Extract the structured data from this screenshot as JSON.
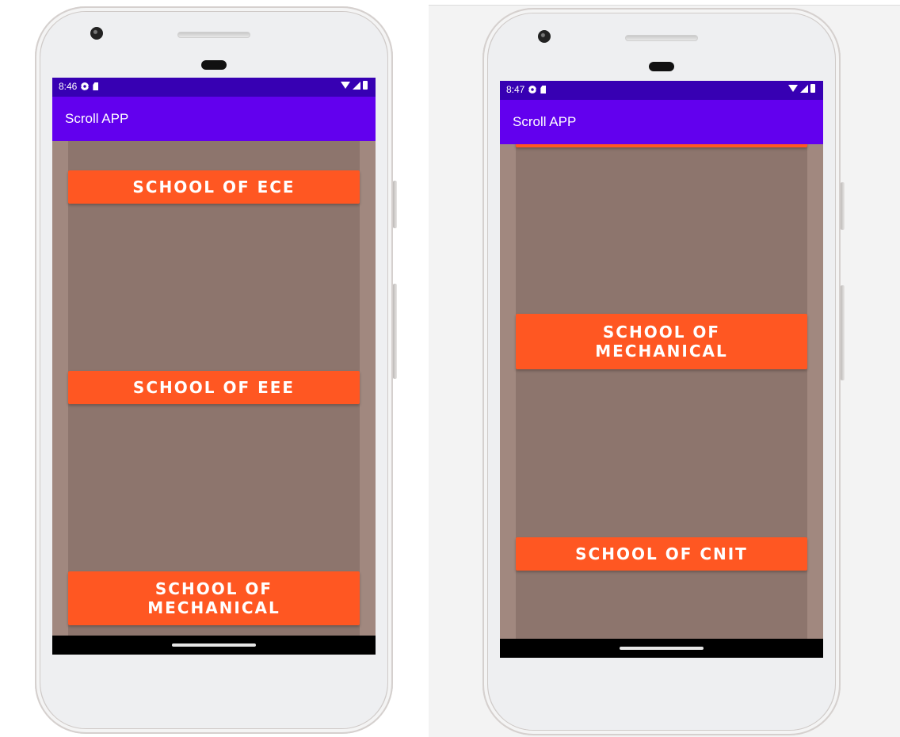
{
  "left_phone": {
    "status": {
      "time": "8:46"
    },
    "appbar": {
      "title": "Scroll APP"
    },
    "buttons": [
      "SCHOOL OF ECE",
      "SCHOOL OF EEE",
      "SCHOOL OF MECHANICAL"
    ]
  },
  "right_phone": {
    "status": {
      "time": "8:47"
    },
    "appbar": {
      "title": "Scroll APP"
    },
    "buttons": [
      "SCHOOL OF MECHANICAL",
      "SCHOOL OF CNIT"
    ]
  },
  "colors": {
    "status_bar": "#3700b3",
    "app_bar": "#6200ee",
    "button": "#ff5722",
    "scroll_background": "#a1887f",
    "inner_background": "#8d756d"
  },
  "icons": {
    "status_left": [
      "settings-gear-icon",
      "sd-card-icon"
    ],
    "status_right": [
      "wifi-icon",
      "signal-icon",
      "battery-icon"
    ]
  }
}
